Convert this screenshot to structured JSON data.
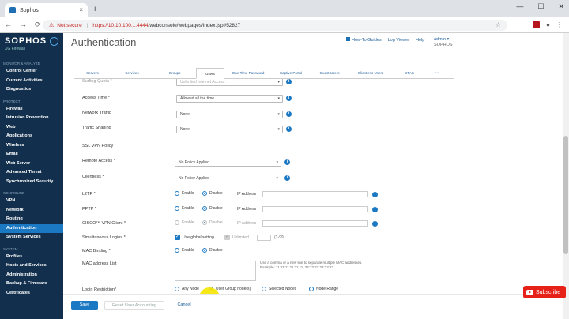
{
  "browser": {
    "tab_title": "Sophos",
    "tab_close": "×",
    "new_tab": "+",
    "window_controls": [
      "—",
      "☐",
      "✕"
    ],
    "nav_icons": [
      "←",
      "→",
      "⟳"
    ],
    "warning_icon": "⚠",
    "not_secure": "Not secure",
    "url_scheme_host": "https://10.10.100.1:4444",
    "url_path": "/webconsole/webpages/index.jsp#52827",
    "star": "☆"
  },
  "sidebar": {
    "brand": "SOPHOS",
    "product": "XG Firewall",
    "sections": [
      {
        "label": "MONITOR & ANALYZE",
        "items": [
          "Control Center",
          "Current Activities",
          "Diagnostics"
        ]
      },
      {
        "label": "PROTECT",
        "items": [
          "Firewall",
          "Intrusion Prevention",
          "Web",
          "Applications",
          "Wireless",
          "Email",
          "Web Server",
          "Advanced Threat",
          "Synchronized Security"
        ]
      },
      {
        "label": "CONFIGURE",
        "items": [
          "VPN",
          "Network",
          "Routing",
          "Authentication",
          "System Services"
        ]
      },
      {
        "label": "SYSTEM",
        "items": [
          "Profiles",
          "Hosts and Services",
          "Administration",
          "Backup & Firmware",
          "Certificates"
        ]
      }
    ],
    "active_item": "Authentication"
  },
  "header": {
    "title": "Authentication",
    "links": [
      "How-To Guides",
      "Log Viewer",
      "Help"
    ],
    "admin_user": "admin ▾",
    "admin_org": "SOPHOS"
  },
  "tabs": [
    "Servers",
    "Services",
    "Groups",
    "Users",
    "One-Time Password",
    "Captive Portal",
    "Guest Users",
    "Clientless Users",
    "STAS",
    "•••"
  ],
  "active_tab": "Users",
  "form": {
    "surfing_quota": {
      "label": "Surfing Quota *",
      "value": "Unlimited Internet Access"
    },
    "access_time": {
      "label": "Access Time *",
      "value": "Allowed all the time"
    },
    "network_traffic": {
      "label": "Network Traffic",
      "value": "None"
    },
    "traffic_shaping": {
      "label": "Traffic Shaping",
      "value": "None"
    },
    "ssl_vpn_heading": "SSL VPN Policy",
    "remote_access": {
      "label": "Remote Access *",
      "value": "No Policy Applied"
    },
    "clientless": {
      "label": "Clientless *",
      "value": "No Policy Applied"
    },
    "l2tp": {
      "label": "L2TP *",
      "enable": "Enable",
      "disable": "Disable",
      "ip_label": "IP Address"
    },
    "pptp": {
      "label": "PPTP *",
      "enable": "Enable",
      "disable": "Disable",
      "ip_label": "IP Address"
    },
    "cisco": {
      "label": "CISCO™ VPN Client *",
      "enable": "Enable",
      "disable": "Disable",
      "ip_label": "IP Address"
    },
    "simultaneous": {
      "label": "Simultaneous Logins *",
      "use_global": "Use global setting",
      "unlimited": "Unlimited",
      "range": "(1-99)"
    },
    "mac_binding": {
      "label": "MAC Binding *",
      "enable": "Enable",
      "disable": "Disable"
    },
    "mac_list": {
      "label": "MAC address List",
      "hint_line1": "Use a comma or a new line to separate multiple MAC addresses.",
      "hint_line2": "Example: 11:11:11:11:11:11, 22:22:22:22:22:22"
    },
    "login_restriction": {
      "label": "Login Restriction*",
      "options": [
        "Any Node",
        "User Group node(s)",
        "Selected Nodes",
        "Node Range"
      ],
      "selected": "User Group node(s)"
    },
    "info_glyph": "i",
    "caret": "▾",
    "check": "✓"
  },
  "footer": {
    "save": "Save",
    "reset": "Reset User Accounting",
    "cancel": "Cancel"
  },
  "subscribe": "Subscribe",
  "colors": {
    "sidebar_bg": "#12304d",
    "accent": "#1b78c2",
    "link": "#1f5f9a",
    "subscribe": "#e62117"
  }
}
